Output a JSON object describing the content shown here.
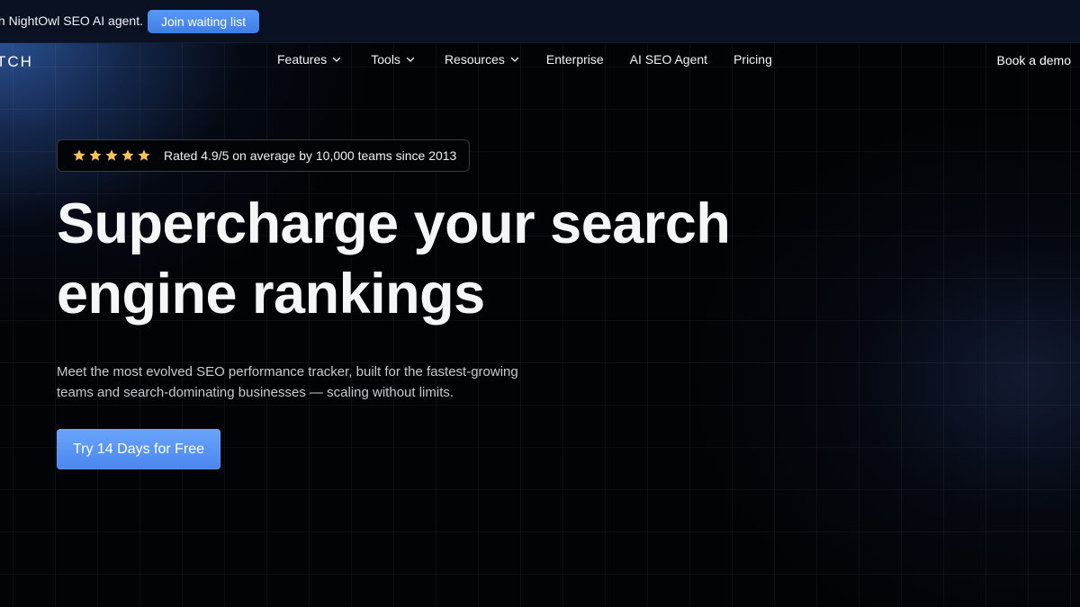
{
  "announcement": {
    "text": "th NightOwl SEO AI agent.",
    "button_label": "Join waiting list",
    "background": "#0a1122",
    "button_color": "#4a88ee"
  },
  "nav": {
    "logo": "TCH",
    "items": [
      {
        "label": "Features",
        "has_dropdown": true,
        "icon": "chevron-down-icon"
      },
      {
        "label": "Tools",
        "has_dropdown": true,
        "icon": "chevron-down-icon"
      },
      {
        "label": "Resources",
        "has_dropdown": true,
        "icon": "chevron-down-icon"
      },
      {
        "label": "Enterprise",
        "has_dropdown": false
      },
      {
        "label": "AI SEO Agent",
        "has_dropdown": false
      },
      {
        "label": "Pricing",
        "has_dropdown": false
      }
    ],
    "book_demo": "Book a demo"
  },
  "hero": {
    "rating": {
      "stars": 5,
      "star_icon": "star-icon",
      "star_color": "#f6c45a",
      "text": "Rated 4.9/5 on average by 10,000 teams since 2013"
    },
    "headline_lines": [
      "Supercharge your search",
      "engine rankings"
    ],
    "subcopy_lines": [
      "Meet the most evolved SEO performance tracker, built for the fastest-growing",
      "teams and search-dominating businesses — scaling without limits."
    ],
    "cta_label": "Try 14 Days for Free",
    "accent_color": "#5a97f6"
  }
}
